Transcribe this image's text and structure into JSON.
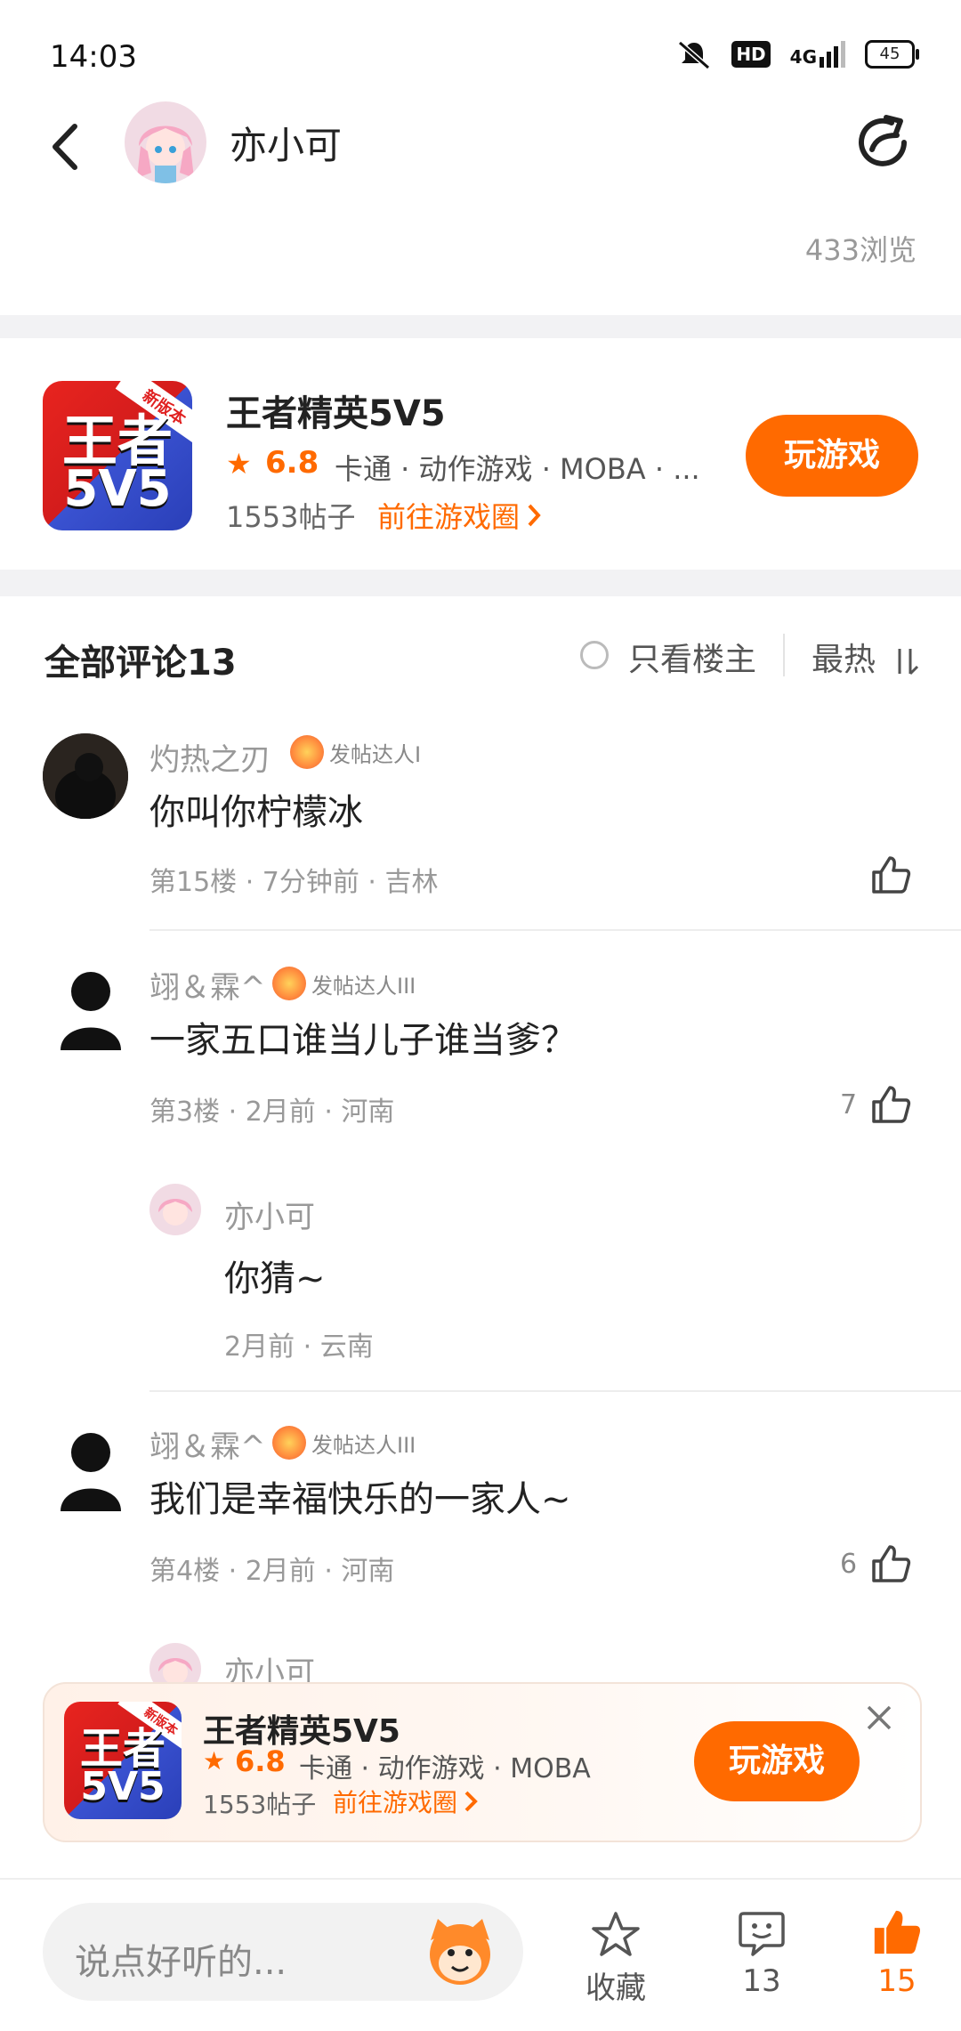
{
  "status_bar": {
    "time": "14:03",
    "hd": "HD",
    "network": "4G",
    "battery": "45"
  },
  "header": {
    "author_name": "亦小可",
    "view_count": "433浏览"
  },
  "game_card": {
    "name": "王者精英5V5",
    "rating": "6.8",
    "tags": "卡通 · 动作游戏 · MOBA · ...",
    "post_count": "1553帖子",
    "goto_label": "前往游戏圈",
    "play_label": "玩游戏",
    "icon_ribbon": "新版本",
    "icon_line1": "王者",
    "icon_line2": "5V5"
  },
  "comments_header": {
    "title": "全部评论13",
    "only_owner": "只看楼主",
    "sort": "最热"
  },
  "comments": [
    {
      "name": "灼热之刃",
      "badge": "发帖达人I",
      "text": "你叫你柠檬冰",
      "meta": "第15楼 · 7分钟前 · 吉林",
      "likes": ""
    },
    {
      "name": "翊＆霖^",
      "badge": "发帖达人III",
      "text": "一家五口谁当儿子谁当爹？",
      "meta": "第3楼 · 2月前 · 河南",
      "likes": "7"
    },
    {
      "name": "亦小可",
      "text": "你猜~",
      "meta": "2月前 · 云南"
    },
    {
      "name": "翊＆霖^",
      "badge": "发帖达人III",
      "text": "我们是幸福快乐的一家人~",
      "meta": "第4楼 · 2月前 · 河南",
      "likes": "6"
    },
    {
      "name": "亦小可"
    }
  ],
  "popup_card": {
    "name": "王者精英5V5",
    "rating": "6.8",
    "tags": "卡通 · 动作游戏 · MOBA",
    "post_count": "1553帖子",
    "goto_label": "前往游戏圈",
    "play_label": "玩游戏"
  },
  "bottom_bar": {
    "input_placeholder": "说点好听的...",
    "favorite_label": "收藏",
    "comment_count": "13",
    "like_count": "15"
  },
  "colors": {
    "accent": "#ff6a00",
    "muted_text": "#999999",
    "divider": "#f2f2f4"
  }
}
